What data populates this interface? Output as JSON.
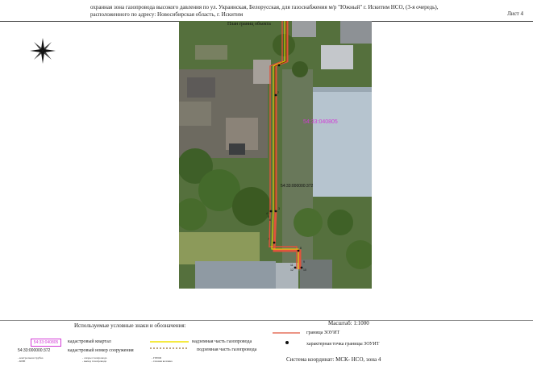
{
  "header": {
    "title_line1": "охранная зона газопровода высокого давления по ул. Украинская, Белорусская, для газоснабжения м/р \"Южный\" г. Искитим НСО, (3-я очередь),",
    "title_line2": "расположенного по адресу:  Новосибирская область, г.  Искитим",
    "sheet": "Лист 4"
  },
  "map": {
    "title": "План границ объекта",
    "quarter_label": "54:33:040805",
    "cadastral_label": "54:33:000000:372",
    "point_labels": [
      "1",
      "2",
      "3",
      "4",
      "5",
      "6",
      "7",
      "8",
      "9",
      "10",
      "11",
      "12"
    ]
  },
  "scale": "Масштаб: 1:1000",
  "legend": {
    "title": "Используемые условные знаки и обозначения:",
    "quarter_swatch": "54:33:040805",
    "quarter_text": "кадастровый квартал",
    "cad_swatch": "54:33:000000:372",
    "cad_text": "кадастровый номер сооружения",
    "small1a": "- контрольная трубка",
    "small1b": "- КИП",
    "small2a": "- опоры газопровода",
    "small2b": "- выход газопровода",
    "small3a": "- ГРПШ",
    "small3b": "- газовая колонка",
    "above": "надземная часть газопровода",
    "under": "подземная часть газопровода",
    "border": "граница ЗОУИТ",
    "point": "характерная точка границы ЗОУИТ",
    "coords": "Система координат: МСК- НСО, зона 4"
  },
  "colors": {
    "zone_border": "#e0533c",
    "above_line": "#f2e400",
    "under_line": "#7a4a00",
    "quarter": "#d23bd6"
  }
}
